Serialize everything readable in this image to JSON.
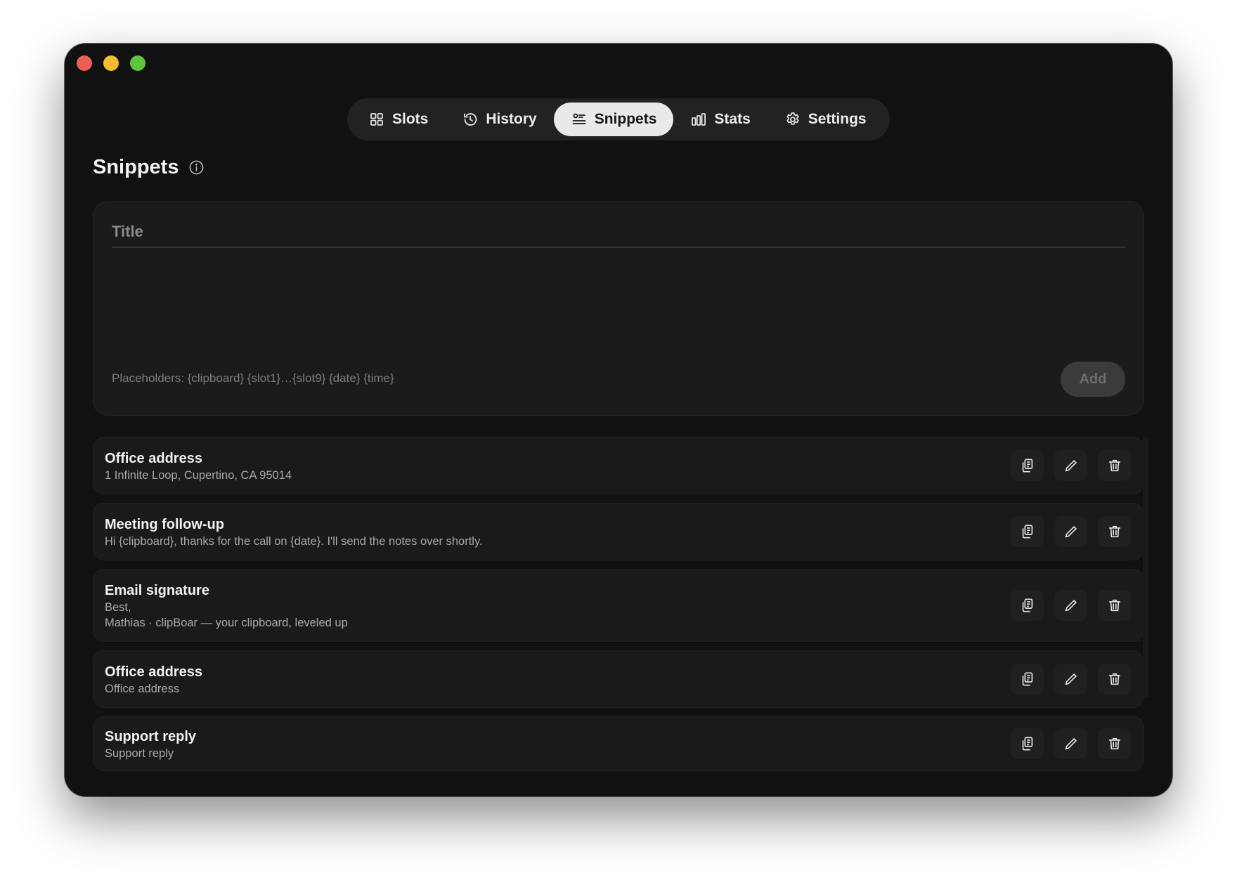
{
  "window": {
    "traffic_lights": [
      "close",
      "minimize",
      "zoom"
    ],
    "colors": {
      "close": "#ec5f57",
      "minimize": "#f5bd2f",
      "zoom": "#5fc53e"
    }
  },
  "tabs": [
    {
      "label": "Slots",
      "icon": "grid-icon",
      "active": false
    },
    {
      "label": "History",
      "icon": "clock-history-icon",
      "active": false
    },
    {
      "label": "Snippets",
      "icon": "snippet-list-icon",
      "active": true
    },
    {
      "label": "Stats",
      "icon": "bar-chart-icon",
      "active": false
    },
    {
      "label": "Settings",
      "icon": "gear-icon",
      "active": false
    }
  ],
  "page": {
    "title": "Snippets",
    "info_icon": "info-icon"
  },
  "composer": {
    "title_placeholder": "Title",
    "title_value": "",
    "body_value": "",
    "hint": "Placeholders: {clipboard} {slot1}…{slot9} {date} {time}",
    "add_label": "Add",
    "add_enabled": false
  },
  "snippets": [
    {
      "title": "Office address",
      "body": "1 Infinite Loop, Cupertino, CA 95014"
    },
    {
      "title": "Meeting follow-up",
      "body": "Hi {clipboard}, thanks for the call on {date}. I'll send the notes over shortly."
    },
    {
      "title": "Email signature",
      "body": "Best,\nMathias · clipBoar — your clipboard, leveled up"
    },
    {
      "title": "Office address",
      "body": "Office address"
    },
    {
      "title": "Support reply",
      "body": "Support reply"
    }
  ],
  "row_actions": [
    "copy-icon",
    "pencil-icon",
    "trash-icon"
  ]
}
